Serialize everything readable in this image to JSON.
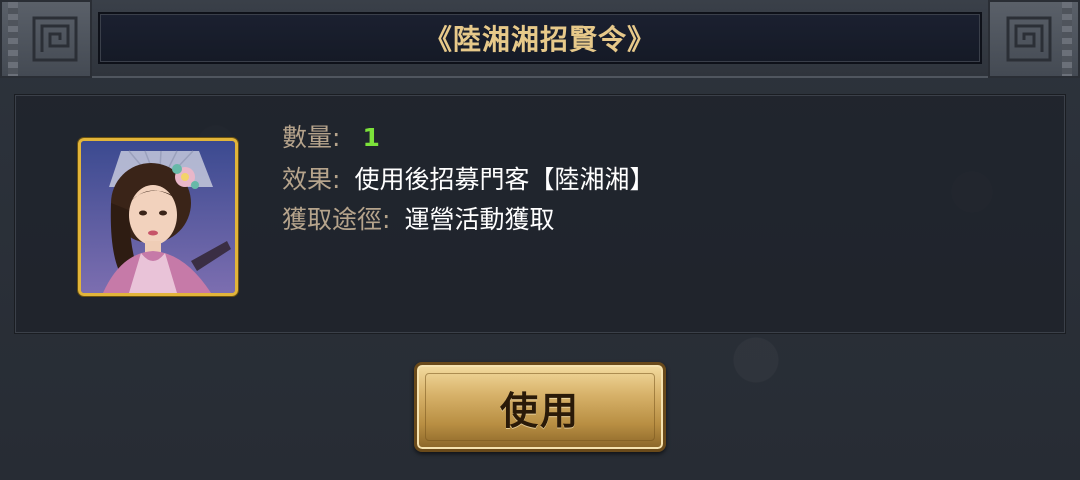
{
  "dialog": {
    "title": "《陸湘湘招賢令》"
  },
  "item": {
    "portrait_icon": "character-portrait",
    "frame_color": "#e2b53a",
    "quantity_label": "數量:",
    "quantity_value": "1",
    "effect_label": "效果:",
    "effect_value": "使用後招募門客【陸湘湘】",
    "source_label": "獲取途徑:",
    "source_value": "運營活動獲取"
  },
  "actions": {
    "use_label": "使用"
  },
  "colors": {
    "title": "#e7c98a",
    "label": "#b6a48c",
    "quantity": "#7ce23a",
    "button_gold": "#d7b26a"
  }
}
